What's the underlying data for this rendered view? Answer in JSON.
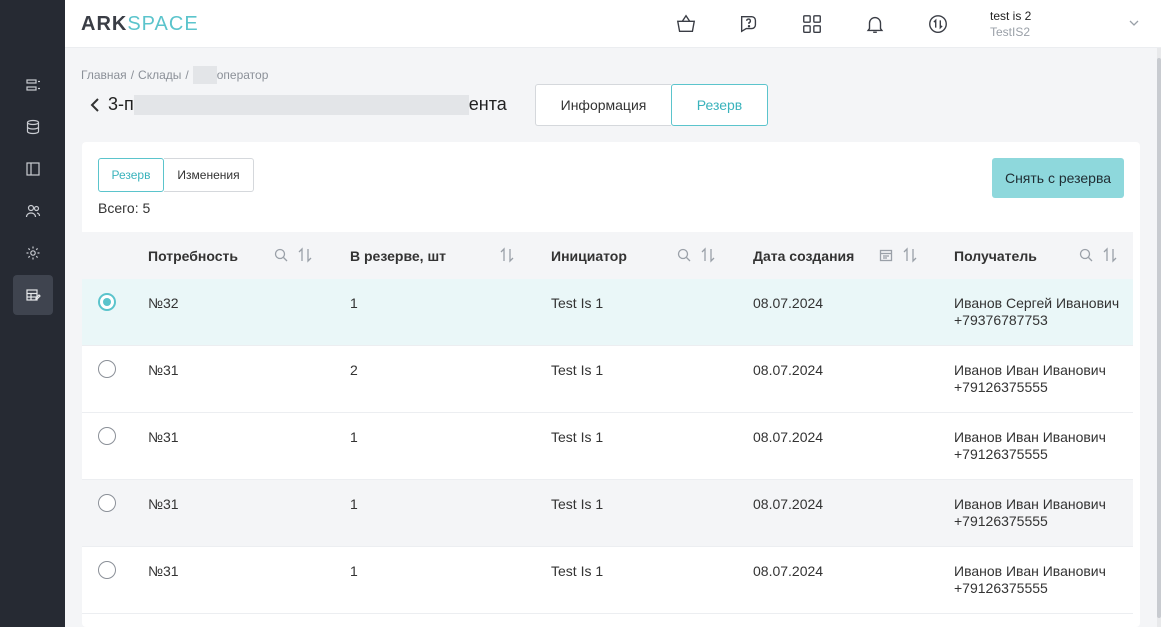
{
  "header": {
    "logo_ark": "ARK",
    "logo_space": "SPACE",
    "user_name": "test is 2",
    "user_org": "TestIS2"
  },
  "sidebar": {
    "items": [
      {
        "icon": "list-icon"
      },
      {
        "icon": "database-icon"
      },
      {
        "icon": "panel-icon"
      },
      {
        "icon": "users-icon"
      },
      {
        "icon": "gear-icon"
      },
      {
        "icon": "table-edit-icon",
        "active": true
      }
    ]
  },
  "breadcrumb": {
    "item1": "Главная",
    "item2": "Склады",
    "item3": "оператор",
    "separator": "/"
  },
  "page": {
    "title_start": "3-п",
    "title_end": "ента"
  },
  "top_tabs": {
    "info": "Информация",
    "reserve": "Резерв"
  },
  "sub_tabs": {
    "reserve": "Резерв",
    "changes": "Изменения"
  },
  "total_label": "Всего: 5",
  "unreserve_button": "Снять с резерва",
  "table": {
    "columns": [
      "Потребность",
      "В резерве, шт",
      "Инициатор",
      "Дата создания",
      "Получатель"
    ],
    "rows": [
      {
        "need": "№32",
        "qty": "1",
        "initiator": "Test Is 1",
        "date": "08.07.2024",
        "recipient": "Иванов Сергей Иванович",
        "phone": "+79376787753",
        "selected": true
      },
      {
        "need": "№31",
        "qty": "2",
        "initiator": "Test Is 1",
        "date": "08.07.2024",
        "recipient": "Иванов Иван Иванович",
        "phone": "+79126375555",
        "selected": false
      },
      {
        "need": "№31",
        "qty": "1",
        "initiator": "Test Is 1",
        "date": "08.07.2024",
        "recipient": "Иванов Иван Иванович",
        "phone": "+79126375555",
        "selected": false
      },
      {
        "need": "№31",
        "qty": "1",
        "initiator": "Test Is 1",
        "date": "08.07.2024",
        "recipient": "Иванов Иван Иванович",
        "phone": "+79126375555",
        "selected": false
      },
      {
        "need": "№31",
        "qty": "1",
        "initiator": "Test Is 1",
        "date": "08.07.2024",
        "recipient": "Иванов Иван Иванович",
        "phone": "+79126375555",
        "selected": false
      }
    ]
  },
  "colors": {
    "accent": "#5bc4cc",
    "sidebar": "#262a33",
    "button": "#8ed8dc"
  }
}
